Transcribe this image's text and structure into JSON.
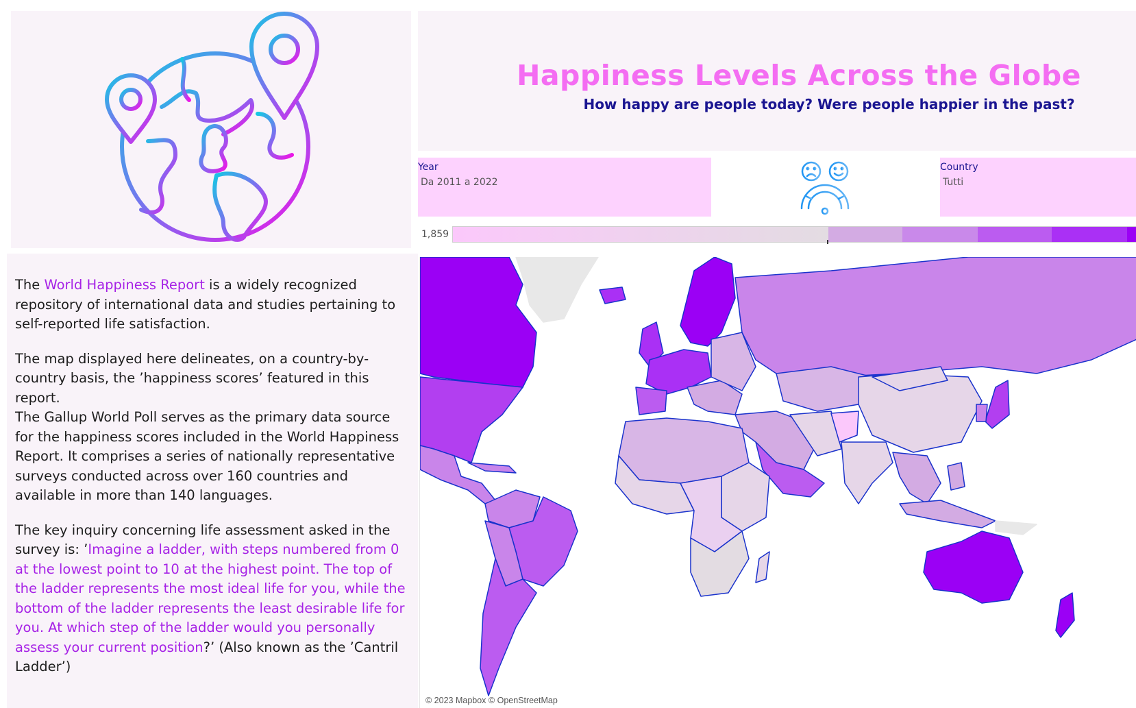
{
  "header": {
    "title": "Happiness Levels Across the Globe",
    "subtitle": "How happy are people today? Were people happier in the past?"
  },
  "filters": {
    "year": {
      "label": "Year",
      "value": "Da 2011 a 2022"
    },
    "country": {
      "label": "Country",
      "value": "Tutti"
    }
  },
  "legend": {
    "min_label": "1,859",
    "colors": [
      "#fbc8fb",
      "#e3dce2",
      "#d3abe3",
      "#c989ea",
      "#bb5cf0",
      "#aa30f5",
      "#9b00f5"
    ]
  },
  "text": {
    "p1_prefix": "The ",
    "p1_link": "World Happiness Report",
    "p1_rest": " is a widely recognized repository of international data and studies pertaining to self-reported life satisfaction.",
    "p2_line1": "The map displayed here delineates, on a country-by-country basis, the ’happiness scores’ featured in this report.",
    "p2_line2": "The Gallup World Poll serves as the primary data source for the happiness scores included in the World Happiness Report. It comprises a series of nationally representative surveys conducted across over 160 countries and available in more than 140 languages.",
    "p3_prefix": "The key inquiry concerning life assessment asked in the survey is: ’",
    "p3_quote": "Imagine a ladder, with steps numbered from 0 at the lowest point to 10 at the highest point. The top of the ladder represents the most ideal life for you, while the bottom of the ladder represents the least desirable life for you. At which step of the ladder would you personally assess your current position",
    "p3_suffix": "?’ (Also known as the ’Cantril Ladder’)"
  },
  "map": {
    "attribution": "© 2023 Mapbox © OpenStreetMap",
    "colors": {
      "high": "#9b00f5",
      "mid_high": "#b23ff0",
      "mid": "#c985ea",
      "low_mid": "#d8b6e6",
      "low": "#e6d6e8",
      "lowest": "#fbc8fb",
      "border": "#1a33cc",
      "nodata": "#e8e8e8"
    }
  },
  "icons": {
    "globe": "globe-with-pins-icon",
    "mood": "mood-gauge-icon"
  }
}
